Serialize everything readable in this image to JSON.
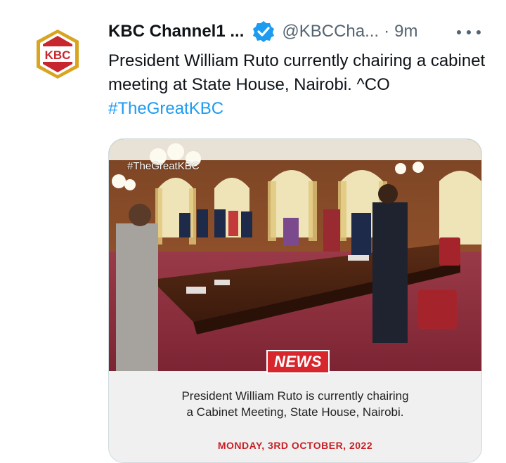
{
  "tweet": {
    "author_name": "KBC Channel1 ...",
    "handle": "@KBCCha...",
    "separator": "·",
    "time": "9m",
    "text": "President William Ruto currently chairing a cabinet meeting at State House, Nairobi. ^CO",
    "hashtag": "#TheGreatKBC",
    "verified_icon": "verified-badge-icon",
    "more_icon": "more-options-icon"
  },
  "avatar": {
    "logo_text": "KBC",
    "colors": {
      "hex": "#c8262e",
      "gold": "#d9a520"
    }
  },
  "media": {
    "watermark": "#TheGreatKBC",
    "badge": "NEWS",
    "caption_line1": "President William Ruto is currently chairing",
    "caption_line2": "a Cabinet Meeting, State House, Nairobi.",
    "date": "MONDAY, 3RD OCTOBER, 2022"
  },
  "colors": {
    "link": "#1d9bf0",
    "verified": "#1d9bf0",
    "text": "#0f1419",
    "muted": "#536471",
    "badge": "#d7262c"
  }
}
